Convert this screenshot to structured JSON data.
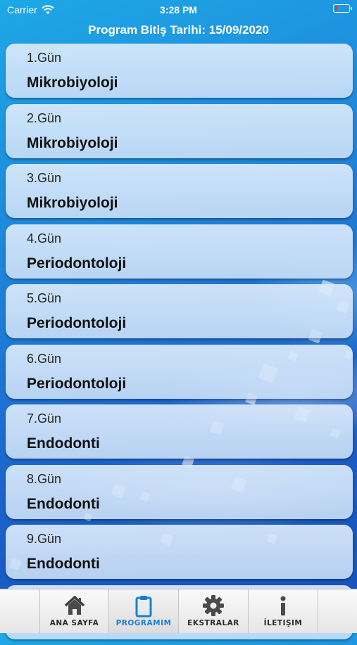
{
  "status": {
    "carrier": "Carrier",
    "time": "3:28 PM"
  },
  "header": {
    "title": "Program Bitiş Tarihi: 15/09/2020"
  },
  "days": [
    {
      "day": "1.Gün",
      "topic": "Mikrobiyoloji"
    },
    {
      "day": "2.Gün",
      "topic": "Mikrobiyoloji"
    },
    {
      "day": "3.Gün",
      "topic": "Mikrobiyoloji"
    },
    {
      "day": "4.Gün",
      "topic": "Periodontoloji"
    },
    {
      "day": "5.Gün",
      "topic": "Periodontoloji"
    },
    {
      "day": "6.Gün",
      "topic": "Periodontoloji"
    },
    {
      "day": "7.Gün",
      "topic": "Endodonti"
    },
    {
      "day": "8.Gün",
      "topic": "Endodonti"
    },
    {
      "day": "9.Gün",
      "topic": "Endodonti"
    }
  ],
  "tabs": [
    {
      "label": "Ana Sayfa",
      "icon": "home-icon",
      "active": false
    },
    {
      "label": "Programim",
      "icon": "clipboard-icon",
      "active": true
    },
    {
      "label": "Ekstralar",
      "icon": "gear-icon",
      "active": false
    },
    {
      "label": "İletişim",
      "icon": "info-icon",
      "active": false
    }
  ],
  "colors": {
    "active_tab": "#1a7fd4",
    "battery_low": "#e53935"
  }
}
